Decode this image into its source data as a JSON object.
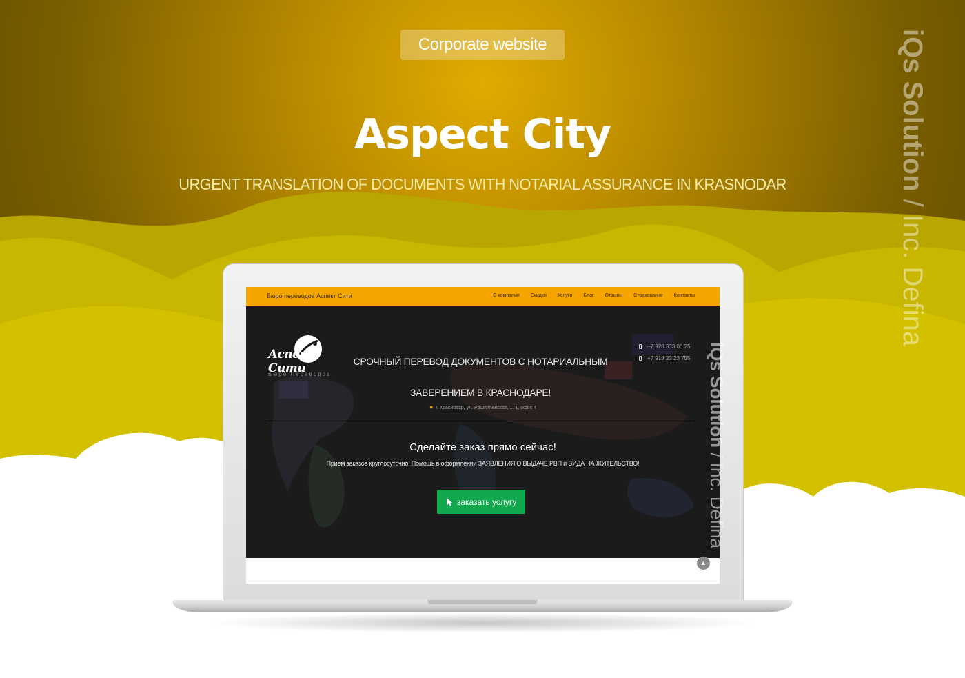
{
  "colors": {
    "bg_dark": "#8a6a00",
    "bg_glow": "#d9a300",
    "hill_yellow": "#cdbd00",
    "nav_orange": "#f5a400",
    "cta_green": "#12a84e"
  },
  "hero": {
    "badge": "Corporate website",
    "title": "Aspect City",
    "subtitle": "URGENT TRANSLATION OF DOCUMENTS WITH NOTARIAL ASSURANCE IN KRASNODAR"
  },
  "watermark": {
    "brand": "iQs Solution",
    "sep": " / ",
    "inc": "Inc. Defina"
  },
  "site": {
    "brand": "Бюро переводов Аспект Сити",
    "menu": [
      "О компании",
      "Скидки",
      "Услуги",
      "Блог",
      "Отзывы",
      "Страхование",
      "Контакты"
    ],
    "logo_text": "Аспект Сити",
    "logo_sub": "Бюро Переводов",
    "heading_line1": "СРОЧНЫЙ ПЕРЕВОД ДОКУМЕНТОВ С НОТАРИАЛЬНЫМ",
    "heading_line2": "ЗАВЕРЕНИЕМ В КРАСНОДАРЕ!",
    "phone1": "+7 928 333 00 25",
    "phone2": "+7 918 23 23 755",
    "address": "г. Краснодар, ул. Рашпилевская, 171, офис 4",
    "cta_heading": "Сделайте заказ прямо сейчас!",
    "cta_sub": "Прием заказов круглосуточно! Помощь в оформлении ЗАЯВЛЕНИЯ О ВЫДАЧЕ РВП и ВИДА НА ЖИТЕЛЬСТВО!",
    "cta_button": "заказать услугу",
    "scroll_top_icon": "chevron-up-icon"
  }
}
